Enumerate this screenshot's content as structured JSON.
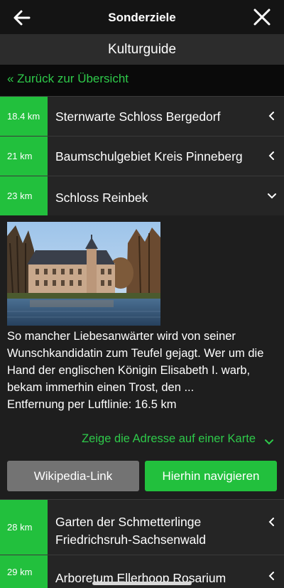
{
  "header": {
    "title": "Sonderziele",
    "back_icon": "arrow-left-icon",
    "close_icon": "close-x-icon"
  },
  "subheader": {
    "title": "Kulturguide"
  },
  "backlink": {
    "label": "« Zurück zur Übersicht"
  },
  "accent_color": "#22c03d",
  "items": [
    {
      "distance": "18.4 km",
      "name": "Sternwarte Schloss Bergedorf",
      "state": "collapsed"
    },
    {
      "distance": "21 km",
      "name": "Baumschulgebiet Kreis Pinneberg",
      "state": "collapsed"
    },
    {
      "distance": "23 km",
      "name": "Schloss Reinbek",
      "state": "expanded"
    },
    {
      "distance": "28 km",
      "name": "Garten der Schmetterlinge Friedrichsruh-Sachsenwald",
      "state": "collapsed"
    },
    {
      "distance": "29 km",
      "name": "Arboretum Ellerhoop Rosarium",
      "state": "collapsed"
    }
  ],
  "detail": {
    "description": "So mancher Liebesanwärter wird von seiner Wunschkandidatin zum Teufel gejagt. Wer um die Hand der englischen Königin Elisabeth I. warb, bekam immerhin einen Trost, den ...",
    "distance_line": "Entfernung per Luftlinie: 16.5 km",
    "map_link": "Zeige die Adresse auf einer Karte",
    "wiki_button": "Wikipedia-Link",
    "navigate_button": "Hierhin navigieren"
  }
}
